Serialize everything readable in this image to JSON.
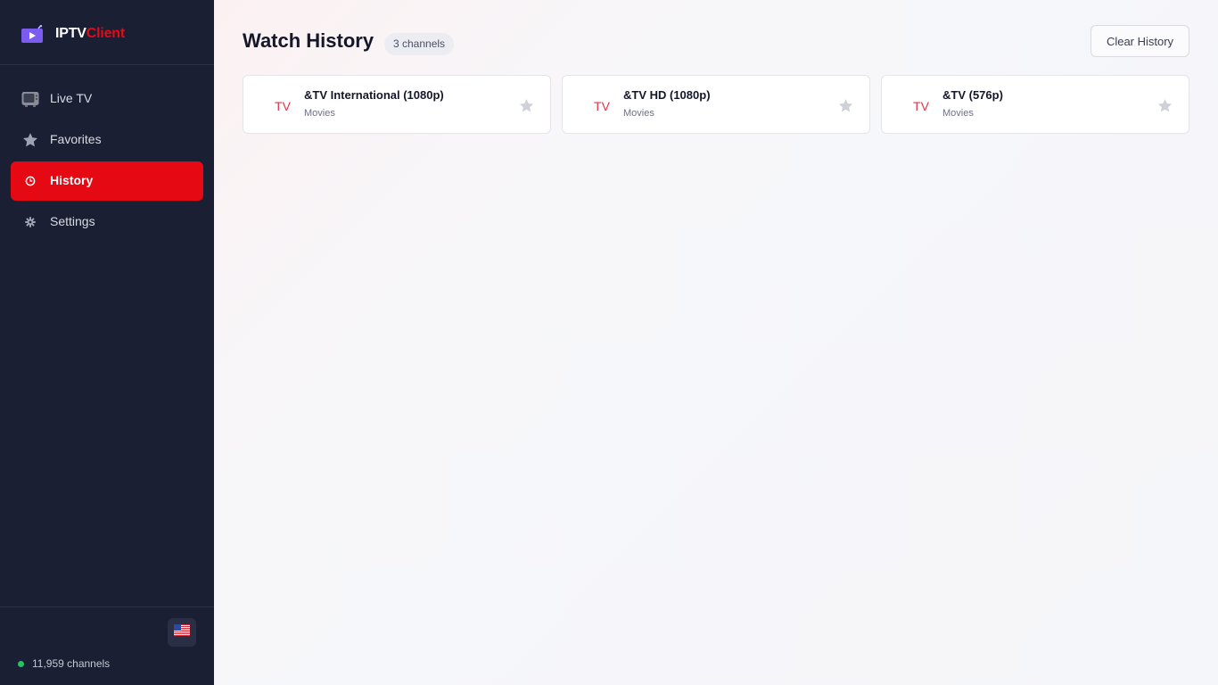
{
  "brand": {
    "name_part1": "IPTV",
    "name_part2": "Client",
    "accent_color": "#e50914"
  },
  "sidebar": {
    "items": [
      {
        "label": "Live TV",
        "icon": "tv-icon",
        "active": false
      },
      {
        "label": "Favorites",
        "icon": "star-icon",
        "active": false
      },
      {
        "label": "History",
        "icon": "clock-icon",
        "active": true
      },
      {
        "label": "Settings",
        "icon": "gear-icon",
        "active": false
      }
    ],
    "footer": {
      "flag_icon": "us-flag-icon",
      "status_text": "11,959 channels",
      "status_color": "#22c55e"
    }
  },
  "main": {
    "title": "Watch History",
    "count_badge": "3 channels",
    "clear_button": "Clear History",
    "channels": [
      {
        "logo_text": "TV",
        "name": "&TV International (1080p)",
        "category": "Movies"
      },
      {
        "logo_text": "TV",
        "name": "&TV HD (1080p)",
        "category": "Movies"
      },
      {
        "logo_text": "TV",
        "name": "&TV (576p)",
        "category": "Movies"
      }
    ]
  }
}
